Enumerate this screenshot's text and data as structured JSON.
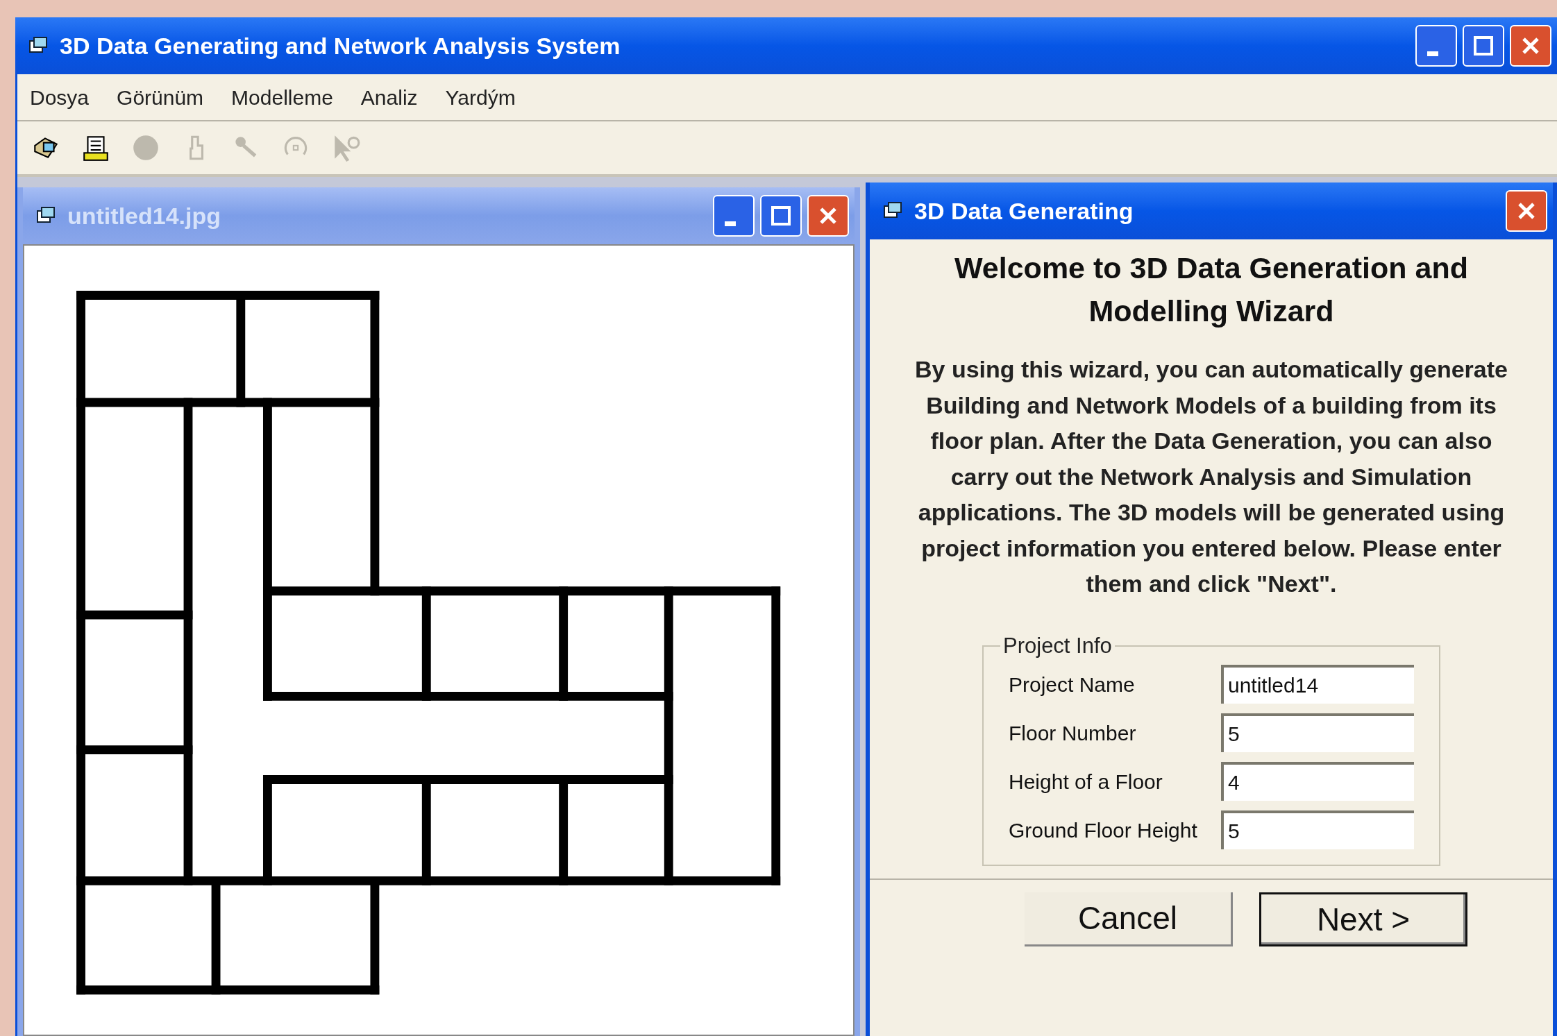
{
  "window": {
    "title": "3D Data Generating and Network Analysis System"
  },
  "menu": [
    "Dosya",
    "Görünüm",
    "Modelleme",
    "Analiz",
    "Yardým"
  ],
  "toolbar": [
    {
      "disabled": false
    },
    {
      "disabled": false
    },
    {
      "disabled": true
    },
    {
      "disabled": true
    },
    {
      "disabled": true
    },
    {
      "disabled": true
    },
    {
      "disabled": true
    }
  ],
  "image_window": {
    "title": "untitled14.jpg",
    "active": false
  },
  "dialog": {
    "title": "3D Data Generating",
    "active": true,
    "heading": "Welcome to 3D Data Generation and Modelling Wizard",
    "intro": "By using this wizard, you can automatically generate Building and Network Models of a building from its floor plan. After the Data Generation, you can also carry out the Network Analysis and Simulation applications. The 3D models will be generated using project information you entered below. Please enter them and click \"Next\".",
    "group": {
      "title": "Project Info",
      "fields": [
        {
          "label": "Project Name",
          "value": "untitled14"
        },
        {
          "label": "Floor Number",
          "value": "5"
        },
        {
          "label": "Height of a Floor",
          "value": "4"
        },
        {
          "label": "Ground Floor Height",
          "value": "5"
        }
      ]
    },
    "buttons": [
      {
        "label": "Cancel",
        "default": false
      },
      {
        "label": "Next >",
        "default": true
      }
    ]
  }
}
